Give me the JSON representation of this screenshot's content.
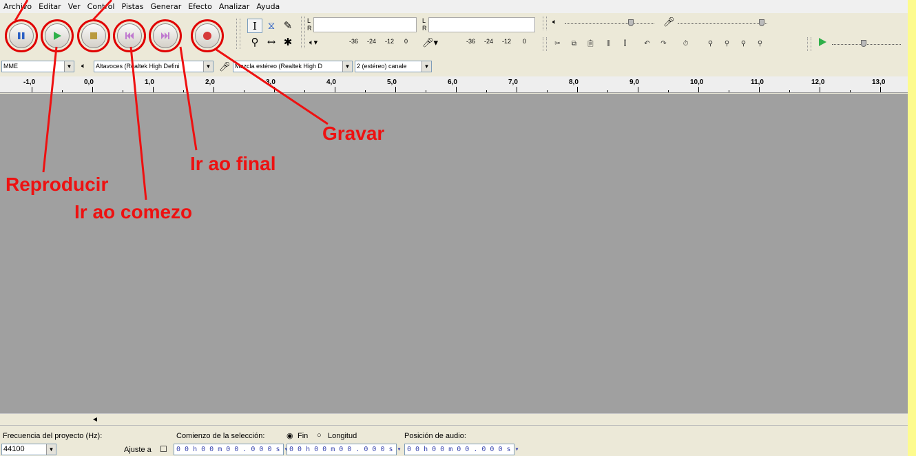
{
  "menu": [
    "Archivo",
    "Editar",
    "Ver",
    "Control",
    "Pistas",
    "Generar",
    "Efecto",
    "Analizar",
    "Ayuda"
  ],
  "meters": {
    "play_L": "L",
    "play_R": "R",
    "rec_L": "L",
    "rec_R": "R",
    "scale": [
      "-36",
      "-24",
      "-12",
      "0"
    ]
  },
  "device": {
    "host": "MME",
    "output": "Altavoces (Realtek High Defini",
    "input": "Mezcla estéreo (Realtek High D",
    "channels": "2 (estéreo) canale"
  },
  "ruler_ticks": [
    "-1,0",
    "0,0",
    "1,0",
    "2,0",
    "3,0",
    "4,0",
    "5,0",
    "6,0",
    "7,0",
    "8,0",
    "9,0",
    "10,0",
    "11,0",
    "12,0",
    "13,0"
  ],
  "selection": {
    "rate_label": "Frecuencia del proyecto (Hz):",
    "rate_value": "44100",
    "start_label": "Comienzo de la selección:",
    "end_option": "Fin",
    "length_option": "Longitud",
    "snap_label": "Ajuste a",
    "position_label": "Posición de audio:",
    "time_start": "0 0 h 0 0 m 0 0 . 0 0 0 s",
    "time_end": "0 0 h 0 0 m 0 0 . 0 0 0 s",
    "time_pos": "0 0 h 0 0 m 0 0 . 0 0 0 s"
  },
  "annotations": {
    "record": "Gravar",
    "skip_end": "Ir ao final",
    "play": "Reproducir",
    "skip_start": "Ir ao comezo"
  },
  "colors": {
    "annotation": "#ee1111",
    "highlight_bg": "#fdfb8e",
    "track_bg": "#a0a0a0"
  }
}
